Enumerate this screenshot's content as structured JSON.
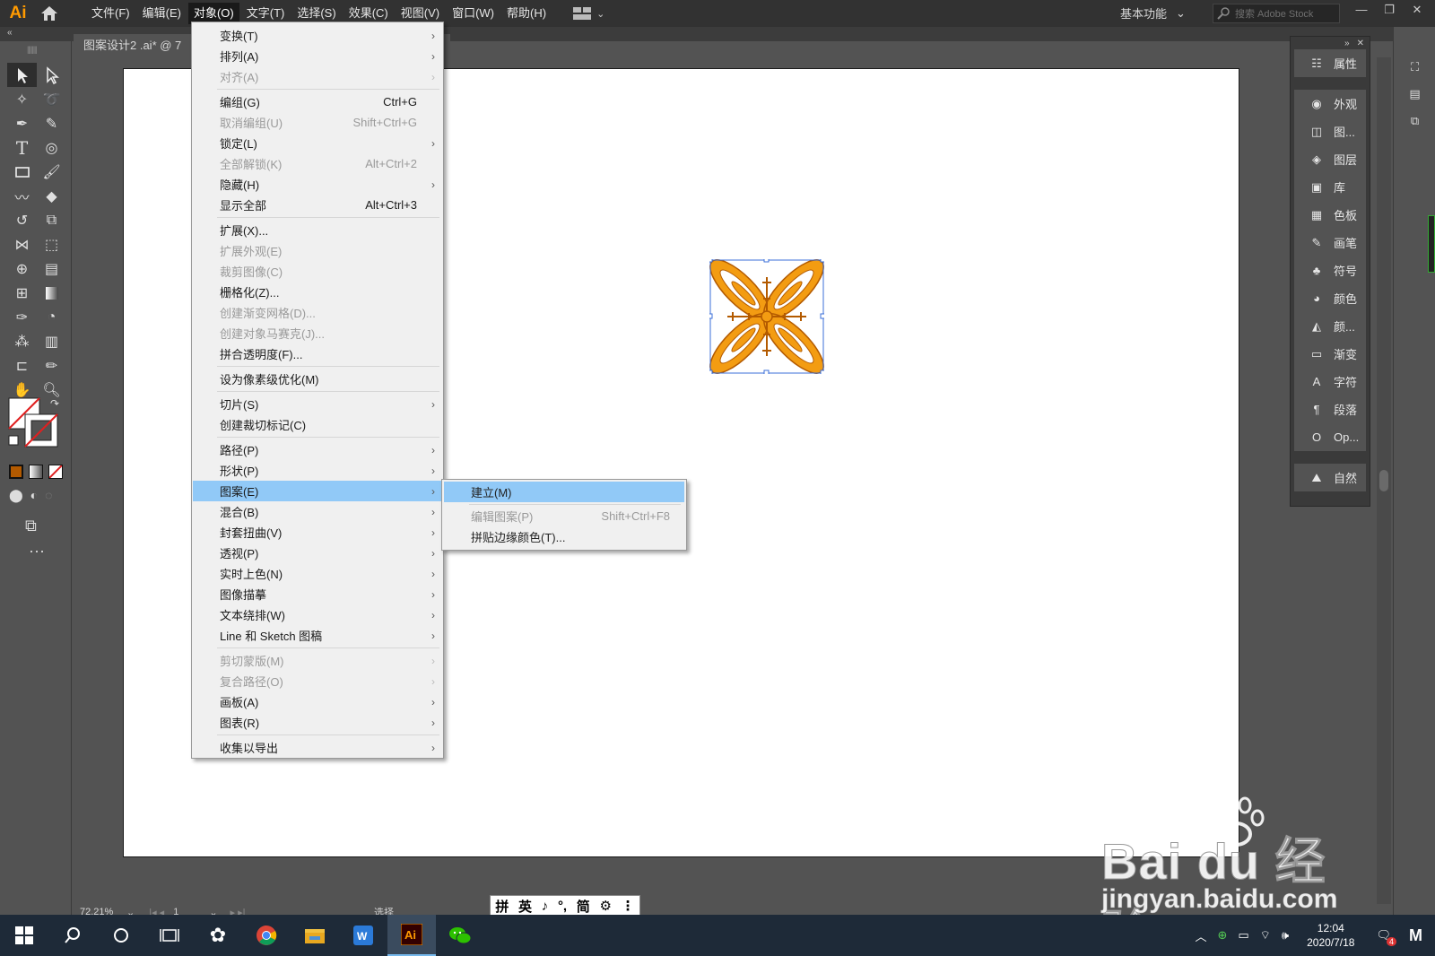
{
  "app": {
    "logo": "Ai",
    "menus": [
      "文件(F)",
      "编辑(E)",
      "对象(O)",
      "文字(T)",
      "选择(S)",
      "效果(C)",
      "视图(V)",
      "窗口(W)",
      "帮助(H)"
    ],
    "active_menu": "对象(O)",
    "workspace": "基本功能",
    "search_placeholder": "搜索 Adobe Stock",
    "doc_tab": "图案设计2 .ai* @ 7"
  },
  "object_menu": [
    {
      "label": "变换(T)",
      "shortcut": "",
      "submenu": true,
      "disabled": false
    },
    {
      "label": "排列(A)",
      "shortcut": "",
      "submenu": true,
      "disabled": false
    },
    {
      "label": "对齐(A)",
      "shortcut": "",
      "submenu": true,
      "disabled": true
    },
    {
      "label": "编组(G)",
      "shortcut": "Ctrl+G",
      "submenu": false,
      "disabled": false
    },
    {
      "label": "取消编组(U)",
      "shortcut": "Shift+Ctrl+G",
      "submenu": false,
      "disabled": true
    },
    {
      "label": "锁定(L)",
      "shortcut": "",
      "submenu": true,
      "disabled": false
    },
    {
      "label": "全部解锁(K)",
      "shortcut": "Alt+Ctrl+2",
      "submenu": false,
      "disabled": true
    },
    {
      "label": "隐藏(H)",
      "shortcut": "",
      "submenu": true,
      "disabled": false
    },
    {
      "label": "显示全部",
      "shortcut": "Alt+Ctrl+3",
      "submenu": false,
      "disabled": false
    },
    {
      "label": "扩展(X)...",
      "shortcut": "",
      "submenu": false,
      "disabled": false
    },
    {
      "label": "扩展外观(E)",
      "shortcut": "",
      "submenu": false,
      "disabled": true
    },
    {
      "label": "裁剪图像(C)",
      "shortcut": "",
      "submenu": false,
      "disabled": true
    },
    {
      "label": "栅格化(Z)...",
      "shortcut": "",
      "submenu": false,
      "disabled": false
    },
    {
      "label": "创建渐变网格(D)...",
      "shortcut": "",
      "submenu": false,
      "disabled": true
    },
    {
      "label": "创建对象马赛克(J)...",
      "shortcut": "",
      "submenu": false,
      "disabled": true
    },
    {
      "label": "拼合透明度(F)...",
      "shortcut": "",
      "submenu": false,
      "disabled": false
    },
    {
      "label": "设为像素级优化(M)",
      "shortcut": "",
      "submenu": false,
      "disabled": false
    },
    {
      "label": "切片(S)",
      "shortcut": "",
      "submenu": true,
      "disabled": false
    },
    {
      "label": "创建裁切标记(C)",
      "shortcut": "",
      "submenu": false,
      "disabled": false
    },
    {
      "label": "路径(P)",
      "shortcut": "",
      "submenu": true,
      "disabled": false
    },
    {
      "label": "形状(P)",
      "shortcut": "",
      "submenu": true,
      "disabled": false
    },
    {
      "label": "图案(E)",
      "shortcut": "",
      "submenu": true,
      "disabled": false,
      "highlighted": true
    },
    {
      "label": "混合(B)",
      "shortcut": "",
      "submenu": true,
      "disabled": false
    },
    {
      "label": "封套扭曲(V)",
      "shortcut": "",
      "submenu": true,
      "disabled": false
    },
    {
      "label": "透视(P)",
      "shortcut": "",
      "submenu": true,
      "disabled": false
    },
    {
      "label": "实时上色(N)",
      "shortcut": "",
      "submenu": true,
      "disabled": false
    },
    {
      "label": "图像描摹",
      "shortcut": "",
      "submenu": true,
      "disabled": false
    },
    {
      "label": "文本绕排(W)",
      "shortcut": "",
      "submenu": true,
      "disabled": false
    },
    {
      "label": "Line 和 Sketch 图稿",
      "shortcut": "",
      "submenu": true,
      "disabled": false
    },
    {
      "label": "剪切蒙版(M)",
      "shortcut": "",
      "submenu": true,
      "disabled": true
    },
    {
      "label": "复合路径(O)",
      "shortcut": "",
      "submenu": true,
      "disabled": true
    },
    {
      "label": "画板(A)",
      "shortcut": "",
      "submenu": true,
      "disabled": false
    },
    {
      "label": "图表(R)",
      "shortcut": "",
      "submenu": true,
      "disabled": false
    },
    {
      "label": "收集以导出",
      "shortcut": "",
      "submenu": true,
      "disabled": false
    }
  ],
  "pattern_submenu": [
    {
      "label": "建立(M)",
      "shortcut": "",
      "disabled": false,
      "highlighted": true
    },
    {
      "label": "编辑图案(P)",
      "shortcut": "Shift+Ctrl+F8",
      "disabled": true
    },
    {
      "label": "拼贴边缘颜色(T)...",
      "shortcut": "",
      "disabled": false
    }
  ],
  "panels": {
    "top": [
      {
        "label": "属性",
        "icon": "properties-icon"
      }
    ],
    "middle": [
      {
        "label": "外观",
        "icon": "appearance-icon"
      },
      {
        "label": "图...",
        "icon": "graphic-styles-icon"
      },
      {
        "label": "图层",
        "icon": "layers-icon"
      },
      {
        "label": "库",
        "icon": "libraries-icon"
      },
      {
        "label": "色板",
        "icon": "swatches-icon"
      },
      {
        "label": "画笔",
        "icon": "brushes-icon"
      },
      {
        "label": "符号",
        "icon": "symbols-icon"
      },
      {
        "label": "颜色",
        "icon": "color-icon"
      },
      {
        "label": "颜...",
        "icon": "color-guide-icon"
      },
      {
        "label": "渐变",
        "icon": "gradient-icon"
      },
      {
        "label": "字符",
        "icon": "character-icon"
      },
      {
        "label": "段落",
        "icon": "paragraph-icon"
      },
      {
        "label": "Op...",
        "icon": "opentype-icon"
      }
    ],
    "bottom": [
      {
        "label": "自然",
        "icon": "nature-icon"
      }
    ]
  },
  "status": {
    "zoom": "72.21%",
    "page": "1",
    "tool": "选择"
  },
  "ime": [
    "拼",
    "英",
    "♪",
    "°,",
    "简",
    "⚙",
    "⋮"
  ],
  "watermark": {
    "big": "Bai du 经验",
    "small": "jingyan.baidu.com"
  },
  "taskbar": {
    "time": "12:04",
    "date": "2020/7/18",
    "notification_count": "4"
  },
  "colors": {
    "flower_orange": "#f39c12",
    "flower_dark": "#b35a00",
    "menu_highlight": "#91c9f7",
    "ui_dark": "#323232"
  }
}
